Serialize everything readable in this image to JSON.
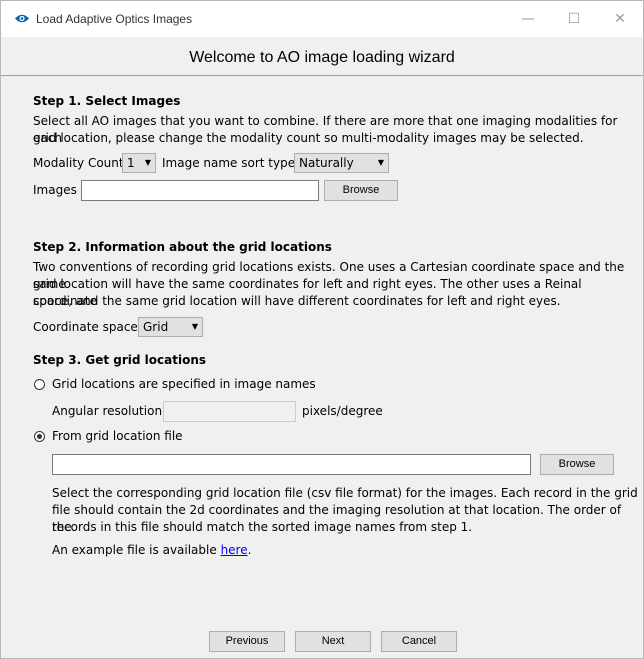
{
  "window": {
    "title": "Load Adaptive Optics Images",
    "minimize_glyph": "—",
    "maximize_glyph": "☐",
    "close_glyph": "✕",
    "app_icon": "eye-icon",
    "accent_color": "#0063b1"
  },
  "header": {
    "title": "Welcome to AO image loading wizard"
  },
  "step1": {
    "heading": "Step 1. Select Images",
    "line1": "Select all AO images that you want to combine. If there are more that one imaging modalities for each",
    "line2": "grid location, please change the modality count so multi-modality images may be selected.",
    "modality_label": "Modality Count",
    "modality_value": "1",
    "sort_label": "Image name sort type",
    "sort_value": "Naturally",
    "images_label": "Images",
    "images_value": "",
    "browse_label": "Browse"
  },
  "step2": {
    "heading": "Step 2. Information about the grid locations",
    "line1": "Two conventions of recording grid locations exists. One uses a Cartesian coordinate space and the same",
    "line2": "grid location will have the same coordinates for left and right eyes. The other uses a Reinal coordinate",
    "line3": "space, and the same grid location will have different coordinates for left and right eyes.",
    "coord_label": "Coordinate space",
    "coord_value": "Grid"
  },
  "step3": {
    "heading": "Step 3. Get grid locations",
    "option1_label": "Grid locations are specified in image names",
    "option1_checked": false,
    "angular_label": "Angular resolution",
    "angular_value": "",
    "angular_unit": "pixels/degree",
    "option2_label": "From grid location file",
    "option2_checked": true,
    "file_value": "",
    "browse_label": "Browse",
    "desc_line1": "Select the corresponding grid location file (csv file format) for the images. Each record in the grid",
    "desc_line2": "file should contain the 2d coordinates and the imaging resolution at that location. The order of the",
    "desc_line3": "records in this file should match the sorted image names from step 1.",
    "example_prefix": "An example file is available ",
    "example_link": "here",
    "example_suffix": "."
  },
  "footer": {
    "previous_label": "Previous",
    "next_label": "Next",
    "cancel_label": "Cancel"
  }
}
